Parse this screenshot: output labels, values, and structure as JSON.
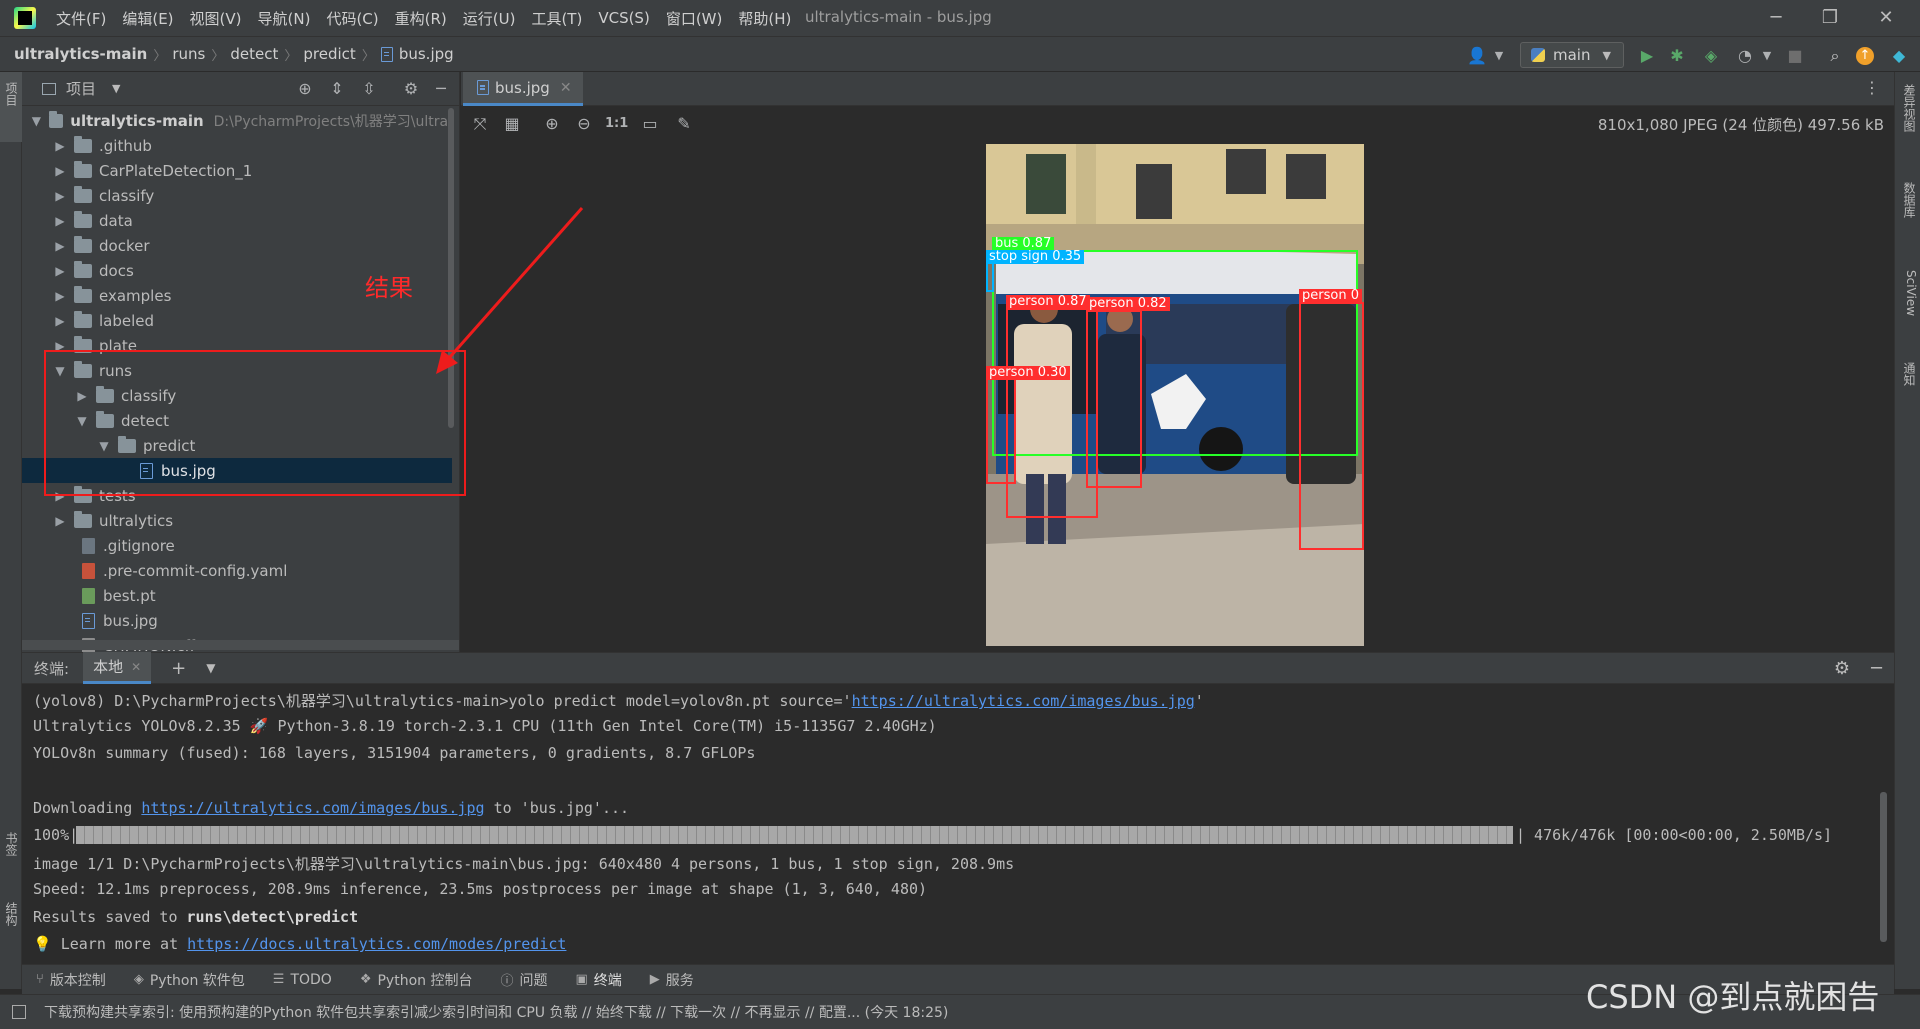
{
  "menu": [
    "文件(F)",
    "编辑(E)",
    "视图(V)",
    "导航(N)",
    "代码(C)",
    "重构(R)",
    "运行(U)",
    "工具(T)",
    "VCS(S)",
    "窗口(W)",
    "帮助(H)"
  ],
  "window_title": "ultralytics-main - bus.jpg",
  "breadcrumbs": [
    "ultralytics-main",
    "runs",
    "detect",
    "predict",
    "bus.jpg"
  ],
  "branch": "main",
  "left_strip": {
    "project": "项目",
    "bookmarks": "书签",
    "structure": "结构"
  },
  "right_strip": {
    "diff": "差异视图",
    "database": "数据库",
    "sciview": "SciView",
    "notifications": "通知"
  },
  "project_panel": {
    "title": "项目",
    "root": {
      "name": "ultralytics-main",
      "path": "D:\\PycharmProjects\\机器学习\\ultral"
    },
    "items": [
      {
        "name": ".github"
      },
      {
        "name": "CarPlateDetection_1"
      },
      {
        "name": "classify"
      },
      {
        "name": "data"
      },
      {
        "name": "docker"
      },
      {
        "name": "docs"
      },
      {
        "name": "examples"
      },
      {
        "name": "labeled"
      },
      {
        "name": "plate"
      },
      {
        "name": "runs"
      },
      {
        "name": "classify"
      },
      {
        "name": "detect"
      },
      {
        "name": "predict"
      },
      {
        "name": "bus.jpg"
      },
      {
        "name": "tests"
      },
      {
        "name": "ultralytics"
      },
      {
        "name": ".gitignore"
      },
      {
        "name": ".pre-commit-config.yaml"
      },
      {
        "name": "best.pt"
      },
      {
        "name": "bus.jpg"
      },
      {
        "name": "CITATION.cff"
      }
    ]
  },
  "annotation": {
    "label": "结果"
  },
  "editor": {
    "tab": "bus.jpg",
    "image_info": "810x1,080 JPEG (24 位颜色) 497.56 kB",
    "zoom_label": "1:1"
  },
  "detections": [
    {
      "label": "bus  0.87",
      "color": "#27ff27"
    },
    {
      "label": "stop sign  0.35",
      "color": "#00b4ff"
    },
    {
      "label": "person  0.87",
      "color": "#ff2e2e"
    },
    {
      "label": "person  0.82",
      "color": "#ff2e2e"
    },
    {
      "label": "person  0.30",
      "color": "#ff2e2e"
    },
    {
      "label": "person  0",
      "color": "#ff2e2e"
    }
  ],
  "terminal": {
    "title": "终端:",
    "tab": "本地",
    "lines": {
      "cmd_prefix": "(yolov8) D:\\PycharmProjects\\机器学习\\ultralytics-main>yolo predict model=yolov8n.pt source='",
      "cmd_url": "https://ultralytics.com/images/bus.jpg",
      "cmd_suffix": "'",
      "version": "Ultralytics YOLOv8.2.35 🚀 Python-3.8.19 torch-2.3.1 CPU (11th Gen Intel Core(TM) i5-1135G7 2.40GHz)",
      "summary": "YOLOv8n summary (fused): 168 layers, 3151904 parameters, 0 gradients, 8.7 GFLOPs",
      "dl_prefix": "Downloading ",
      "dl_url": "https://ultralytics.com/images/bus.jpg",
      "dl_suffix": " to 'bus.jpg'...",
      "progress_label": "100%|",
      "progress_tail": "| 476k/476k [00:00<00:00, 2.50MB/s]",
      "progress_value": 1.0,
      "image": "image 1/1 D:\\PycharmProjects\\机器学习\\ultralytics-main\\bus.jpg: 640x480 4 persons, 1 bus, 1 stop sign, 208.9ms",
      "speed": "Speed: 12.1ms preprocess, 208.9ms inference, 23.5ms postprocess per image at shape (1, 3, 640, 480)",
      "saved_prefix": "Results saved to ",
      "saved_path": "runs\\detect\\predict",
      "learn_prefix": "💡 Learn more at ",
      "learn_url": "https://docs.ultralytics.com/modes/predict"
    }
  },
  "tool_tabs": [
    "版本控制",
    "Python 软件包",
    "TODO",
    "Python 控制台",
    "问题",
    "终端",
    "服务"
  ],
  "status": "下载预构建共享索引: 使用预构建的Python 软件包共享索引减少索引时间和 CPU 负载 // 始终下载 // 下载一次 // 不再显示 // 配置... (今天 18:25)",
  "watermark": "CSDN @到点就困告"
}
